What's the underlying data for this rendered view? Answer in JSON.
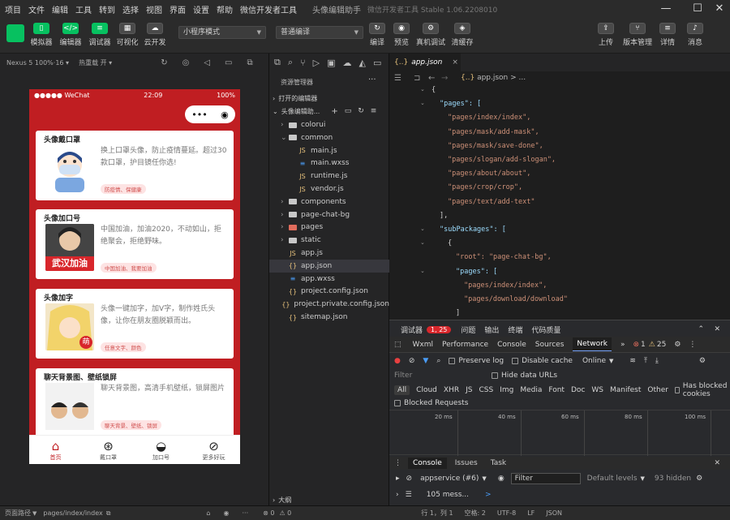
{
  "menubar": {
    "items": [
      "项目",
      "文件",
      "编辑",
      "工具",
      "转到",
      "选择",
      "视图",
      "界面",
      "设置",
      "帮助",
      "微信开发者工具"
    ],
    "title": "头像编辑助手",
    "subtitle": "微信开发者工具 Stable 1.06.2208010"
  },
  "toolbar": {
    "simulator": "模拟器",
    "editor": "编辑器",
    "debugger": "调试器",
    "visual": "可视化",
    "cloud": "云开发",
    "mode_select": "小程序模式",
    "compile_select": "普通编译",
    "compile": "编译",
    "preview": "预览",
    "realdebug": "真机调试",
    "clearcache": "清缓存",
    "upload": "上传",
    "version": "版本管理",
    "details": "详情",
    "messages": "消息"
  },
  "simulator": {
    "device": "Nexus 5 100%·16 ▾",
    "hotreload": "热重载 开 ▾",
    "status_left": "●●●●● WeChat",
    "status_time": "22:09",
    "status_right": "100%",
    "capsule_more": "•••",
    "capsule_close": "◉",
    "cards": [
      {
        "title": "头像戴口罩",
        "desc": "换上口罩头像，防止疫情蔓延。超过30款口罩，护目镜任你选!",
        "tags": "防疫情、保健康"
      },
      {
        "title": "头像加口号",
        "desc": "中国加油，加油2020，不动如山，拒绝聚会，拒绝野味。",
        "tags": "中国加油、我要加油",
        "badge": "武汉加油"
      },
      {
        "title": "头像加字",
        "desc": "头像一键加字，加V字，制作姓氏头像，让你在朋友圈脱颖而出。",
        "tags": "任意文字、颜色",
        "badge": "萌"
      },
      {
        "title": "聊天背景图、壁纸锁屏",
        "desc": "聊天背景图，高清手机壁纸，锁屏图片",
        "tags": "聊天背景、壁纸、锁屏"
      }
    ],
    "tabs": [
      {
        "label": "首页",
        "icon": "⌂"
      },
      {
        "label": "戴口罩",
        "icon": "⊛"
      },
      {
        "label": "加口号",
        "icon": "◒"
      },
      {
        "label": "更多好玩",
        "icon": "⊘"
      }
    ]
  },
  "explorer": {
    "header": "资源管理器",
    "more": "···",
    "open_editors": "打开的编辑器",
    "project": "头像编辑助...",
    "items": [
      {
        "label": "colorui",
        "type": "folder",
        "indent": 1,
        "arrow": "›"
      },
      {
        "label": "common",
        "type": "folder-open",
        "indent": 1,
        "arrow": "⌄"
      },
      {
        "label": "main.js",
        "type": "js",
        "indent": 2
      },
      {
        "label": "main.wxss",
        "type": "wxss",
        "indent": 2
      },
      {
        "label": "runtime.js",
        "type": "js",
        "indent": 2
      },
      {
        "label": "vendor.js",
        "type": "js",
        "indent": 2
      },
      {
        "label": "components",
        "type": "folder",
        "indent": 1,
        "arrow": "›"
      },
      {
        "label": "page-chat-bg",
        "type": "folder",
        "indent": 1,
        "arrow": "›"
      },
      {
        "label": "pages",
        "type": "folder-red",
        "indent": 1,
        "arrow": "›"
      },
      {
        "label": "static",
        "type": "folder",
        "indent": 1,
        "arrow": "›"
      },
      {
        "label": "app.js",
        "type": "js",
        "indent": 1
      },
      {
        "label": "app.json",
        "type": "json",
        "indent": 1
      },
      {
        "label": "app.wxss",
        "type": "wxss",
        "indent": 1
      },
      {
        "label": "project.config.json",
        "type": "json",
        "indent": 1
      },
      {
        "label": "project.private.config.json",
        "type": "json",
        "indent": 1
      },
      {
        "label": "sitemap.json",
        "type": "json",
        "indent": 1
      }
    ],
    "outline": "大纲",
    "errors": "⊗ 0",
    "warnings": "⚠ 0"
  },
  "editor": {
    "tab": "app.json",
    "tab_icon": "{..}",
    "close": "×",
    "breadcrumb_icon": "{..}",
    "breadcrumb": "app.json > ...",
    "lines": [
      {
        "text": "{",
        "cls": "",
        "indent": 0,
        "fold": true
      },
      {
        "text": "\"pages\": [",
        "cls": "key",
        "indent": 1,
        "fold": true
      },
      {
        "text": "\"pages/index/index\",",
        "cls": "str",
        "indent": 2
      },
      {
        "text": "\"pages/mask/add-mask\",",
        "cls": "str",
        "indent": 2
      },
      {
        "text": "\"pages/mask/save-done\",",
        "cls": "str",
        "indent": 2
      },
      {
        "text": "\"pages/slogan/add-slogan\",",
        "cls": "str",
        "indent": 2
      },
      {
        "text": "\"pages/about/about\",",
        "cls": "str",
        "indent": 2
      },
      {
        "text": "\"pages/crop/crop\",",
        "cls": "str",
        "indent": 2
      },
      {
        "text": "\"pages/text/add-text\"",
        "cls": "str",
        "indent": 2
      },
      {
        "text": "],",
        "cls": "",
        "indent": 1
      },
      {
        "text": "\"subPackages\": [",
        "cls": "key",
        "indent": 1,
        "fold": true
      },
      {
        "text": "{",
        "cls": "",
        "indent": 2,
        "fold": true
      },
      {
        "text": "\"root\": \"page-chat-bg\",",
        "cls": "str",
        "indent": 3
      },
      {
        "text": "\"pages\": [",
        "cls": "key",
        "indent": 3,
        "fold": true
      },
      {
        "text": "\"pages/index/index\",",
        "cls": "str",
        "indent": 4
      },
      {
        "text": "\"pages/download/download\"",
        "cls": "str",
        "indent": 4
      },
      {
        "text": "]",
        "cls": "",
        "indent": 3
      }
    ]
  },
  "devtools": {
    "tabs": [
      "调试器",
      "问题",
      "输出",
      "终端",
      "代码质量"
    ],
    "error_badge": "1, 25",
    "panel_tabs": [
      "Wxml",
      "Performance",
      "Console",
      "Sources",
      "Network"
    ],
    "active_panel": "Network",
    "err_count": "1",
    "warn_count": "25",
    "preserve_log": "Preserve log",
    "disable_cache": "Disable cache",
    "throttle": "Online",
    "filter_placeholder": "Filter",
    "hide_data_urls": "Hide data URLs",
    "types": [
      "All",
      "Cloud",
      "XHR",
      "JS",
      "CSS",
      "Img",
      "Media",
      "Font",
      "Doc",
      "WS",
      "Manifest",
      "Other"
    ],
    "blocked_cookies": "Has blocked cookies",
    "blocked_requests": "Blocked Requests",
    "ticks": [
      "20 ms",
      "40 ms",
      "60 ms",
      "80 ms",
      "100 ms"
    ],
    "console_tab": "Console",
    "issues_tab": "Issues",
    "task_tab": "Task",
    "context": "appservice (#6)",
    "console_filter": "Filter",
    "levels": "Default levels",
    "hidden": "93 hidden",
    "messages": "105 mess...",
    "prompt": ">"
  },
  "statusbar": {
    "path_label": "页面路径",
    "path": "pages/index/index",
    "position": "行 1，列 1",
    "spaces": "空格: 2",
    "encoding": "UTF-8",
    "eol": "LF",
    "lang": "JSON"
  }
}
